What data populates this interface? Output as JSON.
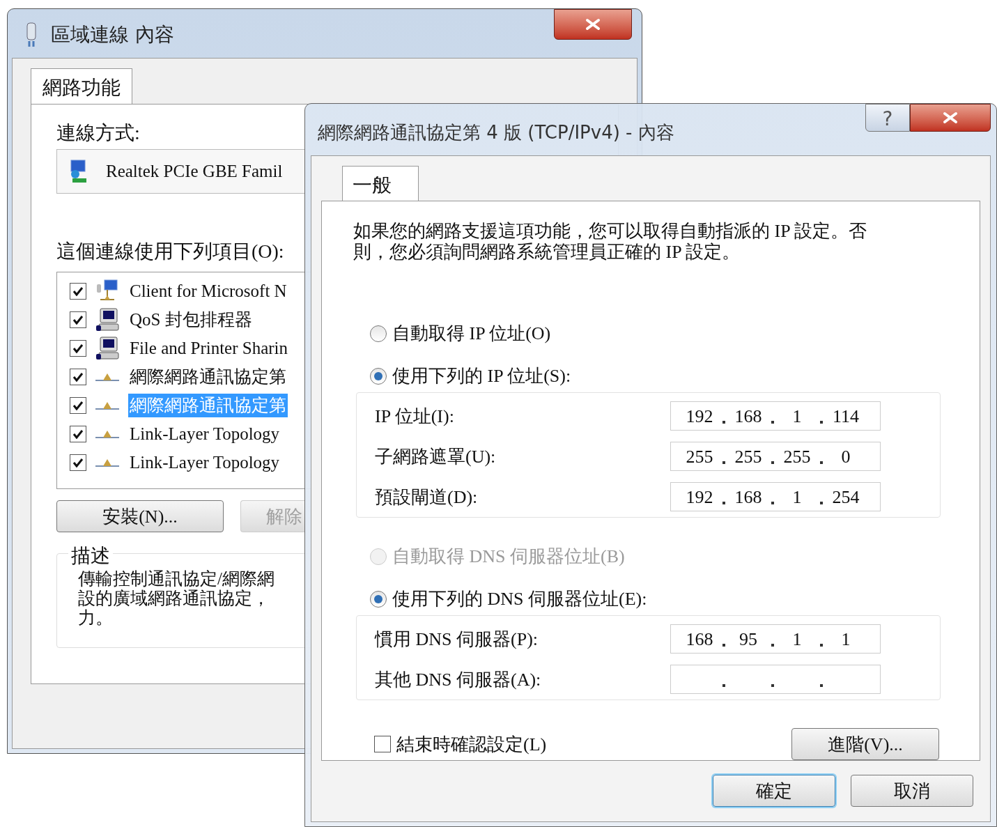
{
  "back_window": {
    "title": "區域連線 內容",
    "tabs": [
      {
        "label": "網路功能",
        "selected": true
      }
    ],
    "connect_using_label": "連線方式:",
    "adapter": "Realtek PCIe GBE Famil",
    "items_label": "這個連線使用下列項目(O):",
    "items": [
      {
        "kind": "client",
        "label": "Client for Microsoft N",
        "checked": true,
        "selected": false
      },
      {
        "kind": "service",
        "label": "QoS 封包排程器",
        "checked": true,
        "selected": false
      },
      {
        "kind": "service",
        "label": "File and Printer Sharin",
        "checked": true,
        "selected": false
      },
      {
        "kind": "protocol",
        "label": "網際網路通訊協定第",
        "checked": true,
        "selected": false
      },
      {
        "kind": "protocol",
        "label": "網際網路通訊協定第",
        "checked": true,
        "selected": true
      },
      {
        "kind": "protocol",
        "label": "Link-Layer Topology",
        "checked": true,
        "selected": false
      },
      {
        "kind": "protocol",
        "label": "Link-Layer Topology",
        "checked": true,
        "selected": false
      }
    ],
    "buttons": [
      {
        "label": "安裝(N)...",
        "disabled": false
      },
      {
        "label": "解除",
        "disabled": true
      }
    ],
    "description": {
      "title": "描述",
      "lines": [
        "傳輸控制通訊協定/網際網",
        "設的廣域網路通訊協定，",
        "力。"
      ]
    }
  },
  "front_window": {
    "title": "網際網路通訊協定第 4 版 (TCP/IPv4) - 內容",
    "help_button": "?",
    "tabs": [
      {
        "label": "一般",
        "selected": true
      }
    ],
    "intro": [
      "如果您的網路支援這項功能，您可以取得自動指派的 IP 設定。否",
      "則，您必須詢問網路系統管理員正確的 IP 設定。"
    ],
    "ip_options": [
      {
        "label": "自動取得 IP 位址(O)",
        "selected": false,
        "disabled": false
      },
      {
        "label": "使用下列的 IP 位址(S):",
        "selected": true,
        "disabled": false
      }
    ],
    "ip_fields": [
      {
        "label": "IP 位址(I):",
        "octets": [
          "192",
          "168",
          "1",
          "114"
        ]
      },
      {
        "label": "子網路遮罩(U):",
        "octets": [
          "255",
          "255",
          "255",
          "0"
        ]
      },
      {
        "label": "預設閘道(D):",
        "octets": [
          "192",
          "168",
          "1",
          "254"
        ]
      }
    ],
    "dns_options": [
      {
        "label": "自動取得 DNS 伺服器位址(B)",
        "selected": false,
        "disabled": true
      },
      {
        "label": "使用下列的 DNS 伺服器位址(E):",
        "selected": true,
        "disabled": false
      }
    ],
    "dns_fields": [
      {
        "label": "慣用 DNS 伺服器(P):",
        "octets": [
          "168",
          "95",
          "1",
          "1"
        ]
      },
      {
        "label": "其他 DNS 伺服器(A):"
      }
    ],
    "validate_on_exit": {
      "label": "結束時確認設定(L)",
      "checked": false
    },
    "advanced_button": "進階(V)...",
    "buttons": [
      {
        "label": "確定",
        "default": true
      },
      {
        "label": "取消",
        "default": false
      }
    ]
  }
}
